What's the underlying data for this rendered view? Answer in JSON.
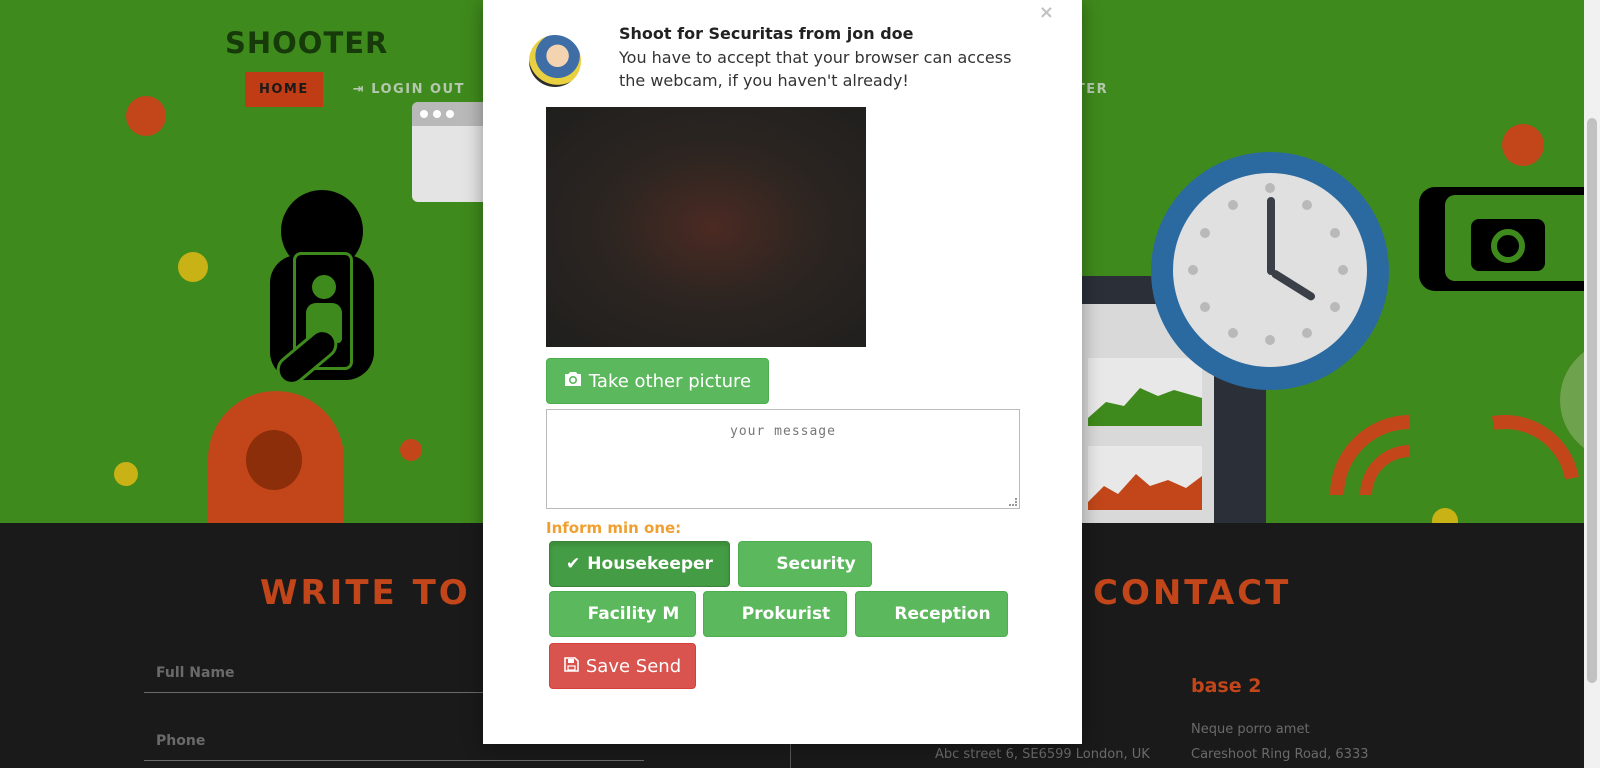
{
  "site": {
    "brand": "SHOOTER",
    "nav": {
      "home": "HOME",
      "login_out": "LOGIN OUT",
      "register_fragment": "STER"
    },
    "lower": {
      "write_title": "WRITE TO U",
      "contact_title": "CONTACT",
      "full_name_placeholder": "Full Name",
      "phone_placeholder": "Phone",
      "base2_title": "base 2",
      "base2_line1": "Neque porro amet",
      "base2_line2": "Careshoot Ring Road, 6333",
      "base1_address": "Abc street 6, SE6599 London, UK"
    }
  },
  "modal": {
    "close": "×",
    "title": "Shoot for Securitas from jon doe",
    "subtitle": "You have to accept that your browser can access the webcam, if you haven't already!",
    "take_picture_label": "Take other picture",
    "message_placeholder": "your message",
    "inform_label": "Inform min one:",
    "recipients": [
      {
        "label": "Housekeeper",
        "checked": true
      },
      {
        "label": "Security",
        "checked": false
      },
      {
        "label": "Facility M",
        "checked": false
      },
      {
        "label": "Prokurist",
        "checked": false
      },
      {
        "label": "Reception",
        "checked": false
      }
    ],
    "save_send_label": "Save Send"
  },
  "icons": {
    "login": "sign-in-icon",
    "camera": "camera-icon",
    "check": "check-icon",
    "save": "floppy-disk-icon",
    "close": "close-icon"
  },
  "colors": {
    "hero_bg": "#3f8a1c",
    "accent_orange": "#c2461a",
    "success_green": "#5cb85c",
    "success_green_active": "#449d44",
    "danger_red": "#d9534f",
    "inform_label": "#f0a030",
    "dark_bg": "#1a1a1a"
  }
}
